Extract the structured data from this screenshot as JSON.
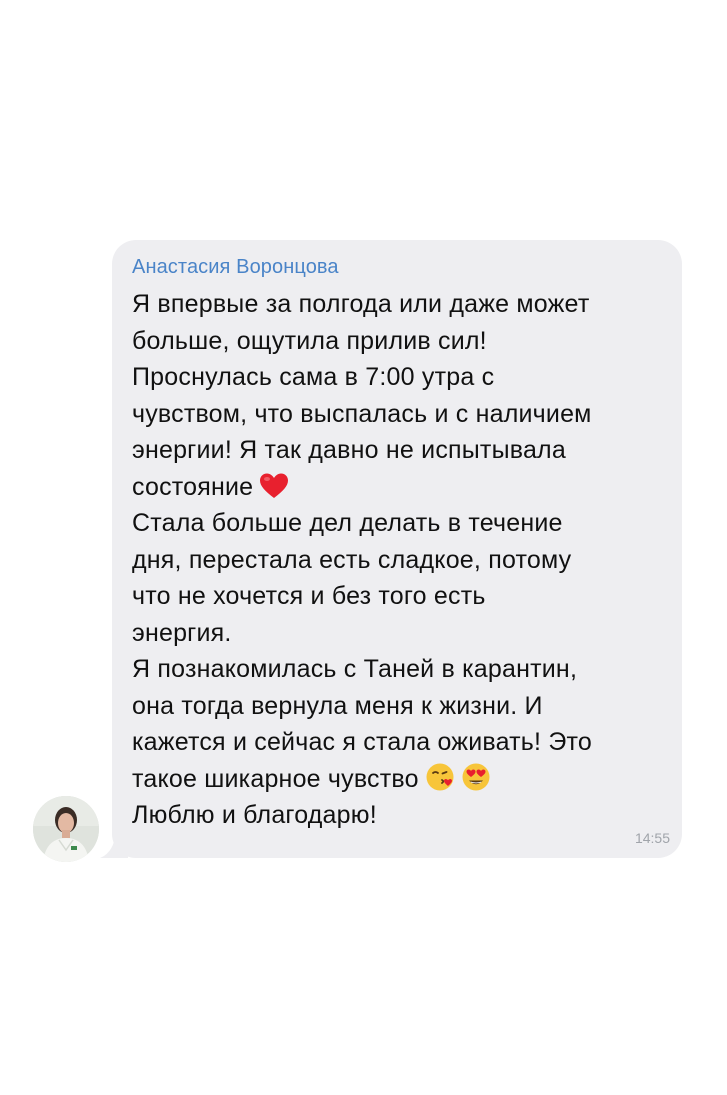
{
  "message": {
    "sender_name": "Анастасия Воронцова",
    "lines": [
      "Я впервые за полгода или даже может",
      "больше, ощутила прилив сил!",
      "Проснулась сама в 7:00 утра с",
      "чувством, что выспалась и с наличием",
      "энергии! Я так давно не испытывала",
      "состояние",
      "Стала больше дел делать в течение",
      "дня, перестала есть сладкое, потому",
      "что не хочется и без того есть",
      "энергия.",
      "Я познакомилась с Таней в карантин,",
      "она тогда вернула меня к жизни. И",
      "кажется и сейчас я стала оживать! Это",
      "такое шикарное чувство",
      "Люблю и благодарю!"
    ],
    "time": "14:55"
  },
  "emojis": {
    "heart": "red-heart-emoji",
    "kiss": "face-blowing-kiss-emoji",
    "heart_eyes": "heart-eyes-emoji"
  },
  "colors": {
    "bubble_bg": "#eeeef1",
    "sender_name": "#4a84c8",
    "text": "#111111",
    "time": "#a0a4aa",
    "heart": "#e8202e",
    "emoji_face": "#f7c53a"
  }
}
